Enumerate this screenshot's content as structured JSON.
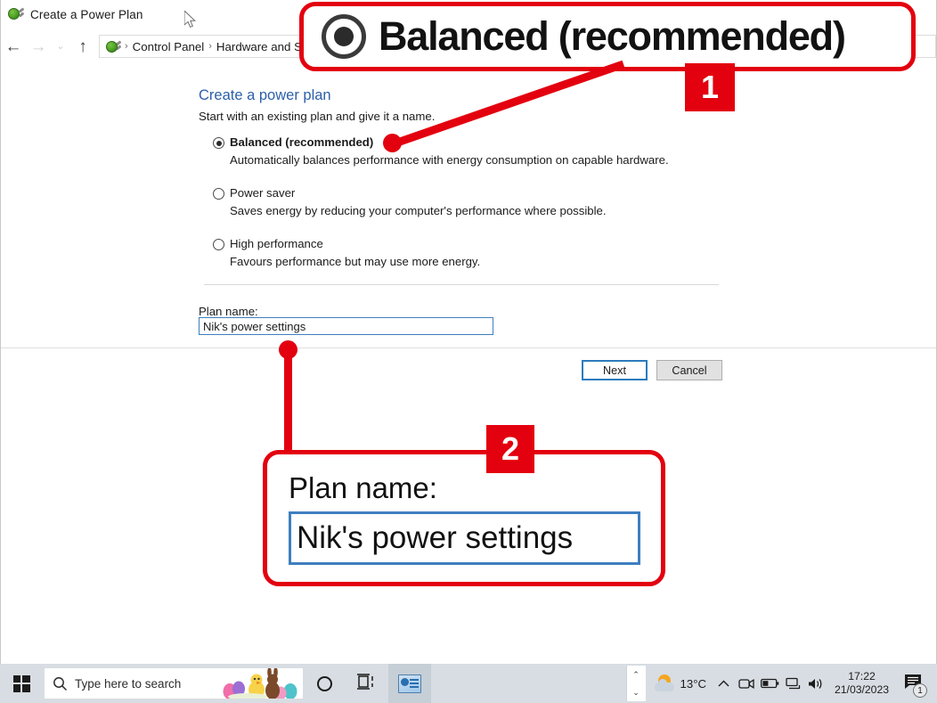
{
  "window": {
    "title": "Create a Power Plan",
    "title_icon": "power-plug-icon",
    "nav": {
      "back_icon": "←",
      "forward_icon": "→",
      "recent_icon": "⌄",
      "up_icon": "↑",
      "breadcrumb_icon": "power-plug-icon",
      "breadcrumbs": [
        "Control Panel",
        "Hardware and So"
      ],
      "separator": "›"
    }
  },
  "page": {
    "title": "Create a power plan",
    "subtitle": "Start with an existing plan and give it a name.",
    "options": [
      {
        "label": "Balanced (recommended)",
        "description": "Automatically balances performance with energy consumption on capable hardware.",
        "selected": true
      },
      {
        "label": "Power saver",
        "description": "Saves energy by reducing your computer's performance where possible.",
        "selected": false
      },
      {
        "label": "High performance",
        "description": "Favours performance but may use more energy.",
        "selected": false
      }
    ],
    "plan_name_label": "Plan name:",
    "plan_name_value": "Nik's power settings",
    "buttons": {
      "next": "Next",
      "cancel": "Cancel"
    }
  },
  "annotations": {
    "accent_color": "#e3000f",
    "callout1": {
      "badge": "1",
      "zoom_of": "Balanced (recommended)",
      "text": "Balanced (recommended)",
      "radio_icon": "radio-selected-icon"
    },
    "callout2": {
      "badge": "2",
      "zoom_of": "Plan name field",
      "label": "Plan name:",
      "value": "Nik's power settings"
    }
  },
  "taskbar": {
    "start_icon": "windows-logo-icon",
    "search": {
      "icon": "search-icon",
      "placeholder": "Type here to search",
      "illustration": "easter-eggs-chick-bunny-icon"
    },
    "cortana_icon": "cortana-circle-icon",
    "task_view_icon": "task-view-icon",
    "pinned_app_icon": "control-panel-icon",
    "tray": {
      "spinner_up": "⌃",
      "spinner_down": "⌄",
      "weather_icon": "sun-behind-cloud-icon",
      "weather_temp": "13°C",
      "show_hidden_icon": "⌃",
      "camera_icon": "camera-icon",
      "battery_icon": "battery-icon",
      "network_icon": "network-icon",
      "volume_icon": "volume-icon",
      "time": "17:22",
      "date": "21/03/2023",
      "action_center_icon": "action-center-icon",
      "notification_count": "1"
    }
  },
  "cursor": {
    "icon": "mouse-pointer-icon"
  }
}
